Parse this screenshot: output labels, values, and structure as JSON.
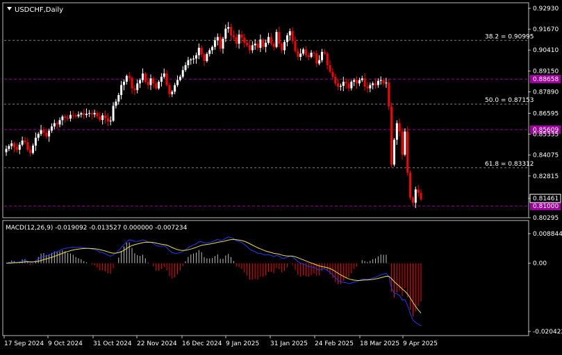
{
  "symbol_label": "USDCHF,Daily",
  "macd_label": "MACD(12,26,9) -0.019092 -0.013527 0.000000 -0.007234",
  "colors": {
    "background": "#000000",
    "bull_candle": "#ffffff",
    "bear_candle": "#ff0000",
    "fib_line": "#808080",
    "level_line": "#a000a0",
    "level_tag": "#a000a0",
    "macd_line": "#1e3cff",
    "signal_line": "#f0e040",
    "hist_pos": "#c0c0c0",
    "hist_neg": "#ff0000",
    "grid_text": "#ffffff",
    "frame": "#c0c0c0"
  },
  "chart_data": [
    {
      "type": "candlestick",
      "ylim": [
        0.80295,
        0.9293
      ],
      "y_ticks": [
        "0.92930",
        "0.91670",
        "0.90410",
        "0.89150",
        "0.87890",
        "0.86595",
        "0.85335",
        "0.84075",
        "0.82815",
        "0.81461",
        "0.80295"
      ],
      "x_ticks": [
        "17 Sep 2024",
        "9 Oct 2024",
        "31 Oct 2024",
        "22 Nov 2024",
        "16 Dec 2024",
        "9 Jan 2025",
        "31 Jan 2025",
        "24 Feb 2025",
        "18 Mar 2025",
        "9 Apr 2025"
      ],
      "fib_levels": [
        {
          "label": "38.2 = 0.90995",
          "value": 0.90995
        },
        {
          "label": "50.0 = 0.87153",
          "value": 0.87153
        },
        {
          "label": "61.8 = 0.83312",
          "value": 0.83312
        }
      ],
      "horizontal_levels": [
        {
          "label": "0.88658",
          "value": 0.88658
        },
        {
          "label": "0.85609",
          "value": 0.85609
        },
        {
          "label": "0.81000",
          "value": 0.81
        }
      ],
      "current_price": "0.81461",
      "closes": [
        0.8445,
        0.8462,
        0.8478,
        0.8455,
        0.844,
        0.847,
        0.8495,
        0.8485,
        0.844,
        0.842,
        0.8465,
        0.8512,
        0.8535,
        0.8558,
        0.8542,
        0.852,
        0.8555,
        0.858,
        0.86,
        0.8592,
        0.8618,
        0.864,
        0.8632,
        0.8628,
        0.865,
        0.8648,
        0.8641,
        0.8652,
        0.866,
        0.8649,
        0.8657,
        0.8661,
        0.8653,
        0.8662,
        0.864,
        0.8619,
        0.8647,
        0.863,
        0.8611,
        0.8615,
        0.8705,
        0.873,
        0.877,
        0.883,
        0.885,
        0.8885,
        0.8873,
        0.881,
        0.88,
        0.884,
        0.886,
        0.89,
        0.885,
        0.883,
        0.887,
        0.884,
        0.881,
        0.885,
        0.888,
        0.89,
        0.883,
        0.8775,
        0.879,
        0.883,
        0.886,
        0.888,
        0.892,
        0.895,
        0.898,
        0.8985,
        0.899,
        0.901,
        0.9055,
        0.9015,
        0.8975,
        0.9018,
        0.904,
        0.906,
        0.91,
        0.912,
        0.905,
        0.911,
        0.917,
        0.918,
        0.913,
        0.912,
        0.908,
        0.9135,
        0.9115,
        0.9085,
        0.907,
        0.904,
        0.907,
        0.908,
        0.9055,
        0.9105,
        0.906,
        0.9085,
        0.912,
        0.908,
        0.906,
        0.915,
        0.908,
        0.904,
        0.909,
        0.913,
        0.9155,
        0.9095,
        0.9035,
        0.9,
        0.902,
        0.9045,
        0.901,
        0.9,
        0.9025,
        0.902,
        0.896,
        0.898,
        0.903,
        0.902,
        0.895,
        0.891,
        0.888,
        0.884,
        0.882,
        0.8825,
        0.885,
        0.884,
        0.881,
        0.885,
        0.886,
        0.884,
        0.886,
        0.887,
        0.882,
        0.881,
        0.883,
        0.884,
        0.883,
        0.8855,
        0.886,
        0.884,
        0.8845,
        0.87,
        0.835,
        0.85,
        0.86,
        0.855,
        0.841,
        0.855,
        0.83,
        0.815,
        0.812,
        0.82,
        0.818,
        0.814
      ],
      "opens_note": ""
    },
    {
      "type": "macd",
      "ylim": [
        -0.020422,
        0.008844
      ],
      "y_ticks": [
        "0.008844",
        "0.00",
        "-0.020422"
      ],
      "params": "12,26,9",
      "values": {
        "macd": -0.019092,
        "signal": -0.013527,
        "hist": 0.0,
        "osma": -0.007234
      }
    }
  ]
}
